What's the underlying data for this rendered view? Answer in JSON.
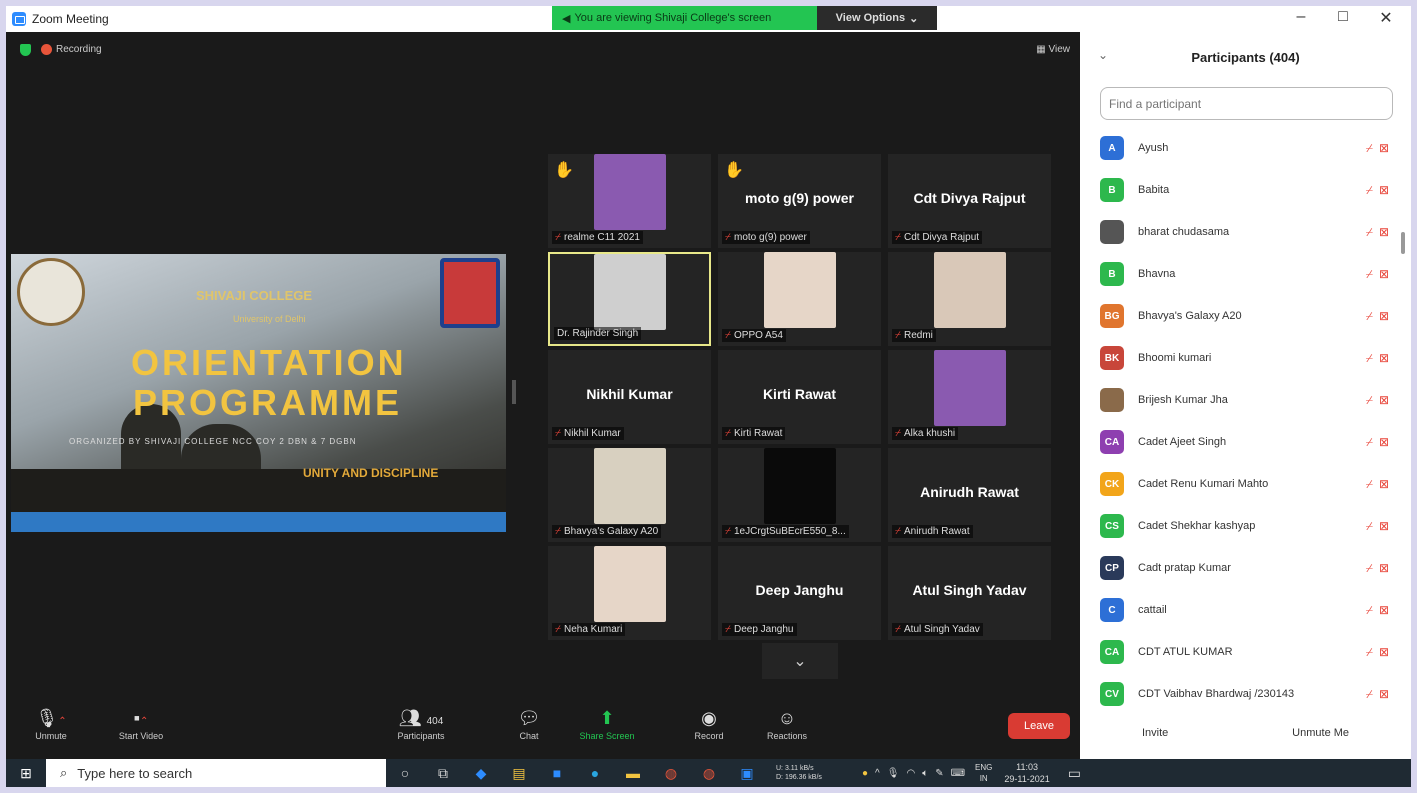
{
  "window": {
    "title": "Zoom Meeting",
    "minimize": "–",
    "maximize": "□",
    "close": "✕"
  },
  "banner": {
    "text": "You are viewing Shivaji College's screen",
    "view_options": "View Options"
  },
  "status": {
    "recording": "Recording",
    "view": "View"
  },
  "slide": {
    "college": "SHIVAJI COLLEGE",
    "university": "University of Delhi",
    "title_line1": "ORIENTATION",
    "title_line2": "PROGRAMME",
    "organizer": "ORGANIZED BY SHIVAJI COLLEGE NCC COY 2 DBN & 7 DGBN",
    "motto": "UNITY AND DISCIPLINE"
  },
  "tiles": [
    {
      "label": "realme C11 2021",
      "name": "",
      "hand": true,
      "photo": true,
      "active": false,
      "muted": true
    },
    {
      "label": "moto g(9) power",
      "name": "moto g(9) power",
      "hand": true,
      "photo": false,
      "active": false,
      "muted": true
    },
    {
      "label": "Cdt Divya Rajput",
      "name": "Cdt Divya Rajput",
      "hand": false,
      "photo": false,
      "active": false,
      "muted": true
    },
    {
      "label": "Dr. Rajinder Singh",
      "name": "",
      "hand": false,
      "photo": true,
      "active": true,
      "muted": false
    },
    {
      "label": "OPPO A54",
      "name": "",
      "hand": false,
      "photo": true,
      "active": false,
      "muted": true
    },
    {
      "label": "Redmi",
      "name": "",
      "hand": false,
      "photo": true,
      "active": false,
      "muted": true
    },
    {
      "label": "Nikhil Kumar",
      "name": "Nikhil Kumar",
      "hand": false,
      "photo": false,
      "active": false,
      "muted": true
    },
    {
      "label": "Kirti Rawat",
      "name": "Kirti Rawat",
      "hand": false,
      "photo": false,
      "active": false,
      "muted": true
    },
    {
      "label": "Alka khushi",
      "name": "",
      "hand": false,
      "photo": true,
      "active": false,
      "muted": true
    },
    {
      "label": "Bhavya's Galaxy A20",
      "name": "",
      "hand": false,
      "photo": true,
      "active": false,
      "muted": true
    },
    {
      "label": "1eJCrgtSuBEcrE550_8...",
      "name": "",
      "hand": false,
      "photo": true,
      "active": false,
      "muted": true
    },
    {
      "label": "Anirudh Rawat",
      "name": "Anirudh Rawat",
      "hand": false,
      "photo": false,
      "active": false,
      "muted": true
    },
    {
      "label": "Neha Kumari",
      "name": "",
      "hand": false,
      "photo": true,
      "active": false,
      "muted": true
    },
    {
      "label": "Deep Janghu",
      "name": "Deep Janghu",
      "hand": false,
      "photo": false,
      "active": false,
      "muted": true
    },
    {
      "label": "Atul Singh Yadav",
      "name": "Atul Singh Yadav",
      "hand": false,
      "photo": false,
      "active": false,
      "muted": true
    }
  ],
  "toolbar": {
    "unmute": "Unmute",
    "start_video": "Start Video",
    "participants": "Participants",
    "participant_count": "404",
    "chat": "Chat",
    "share_screen": "Share Screen",
    "record": "Record",
    "reactions": "Reactions",
    "leave": "Leave"
  },
  "panel": {
    "title": "Participants (404)",
    "search_placeholder": "Find a participant",
    "invite": "Invite",
    "unmute_me": "Unmute Me",
    "participants": [
      {
        "initials": "A",
        "name": "Ayush",
        "color": "#2d6fd6"
      },
      {
        "initials": "B",
        "name": "Babita",
        "color": "#2db84d"
      },
      {
        "initials": "",
        "name": "bharat chudasama",
        "color": "#555555"
      },
      {
        "initials": "B",
        "name": "Bhavna",
        "color": "#2db84d"
      },
      {
        "initials": "BG",
        "name": "Bhavya's Galaxy A20",
        "color": "#e0752e"
      },
      {
        "initials": "BK",
        "name": "Bhoomi kumari",
        "color": "#c8463a"
      },
      {
        "initials": "",
        "name": "Brijesh Kumar Jha",
        "color": "#8a6a4a"
      },
      {
        "initials": "CA",
        "name": "Cadet Ajeet Singh",
        "color": "#8e3fb0"
      },
      {
        "initials": "CK",
        "name": "Cadet Renu Kumari Mahto",
        "color": "#f2a51a"
      },
      {
        "initials": "CS",
        "name": "Cadet Shekhar kashyap",
        "color": "#2db84d"
      },
      {
        "initials": "CP",
        "name": "Cadt pratap Kumar",
        "color": "#2a3a5a"
      },
      {
        "initials": "C",
        "name": "cattail",
        "color": "#2d6fd6"
      },
      {
        "initials": "CA",
        "name": "CDT ATUL KUMAR",
        "color": "#2db84d"
      },
      {
        "initials": "CV",
        "name": "CDT Vaibhav Bhardwaj /230143",
        "color": "#2db84d"
      }
    ]
  },
  "taskbar": {
    "search": "Type here to search",
    "net_up": "U: 3.11 kB/s",
    "net_down": "D: 196.36 kB/s",
    "lang": "ENG",
    "region": "IN",
    "time": "11:03",
    "date": "29-11-2021"
  }
}
